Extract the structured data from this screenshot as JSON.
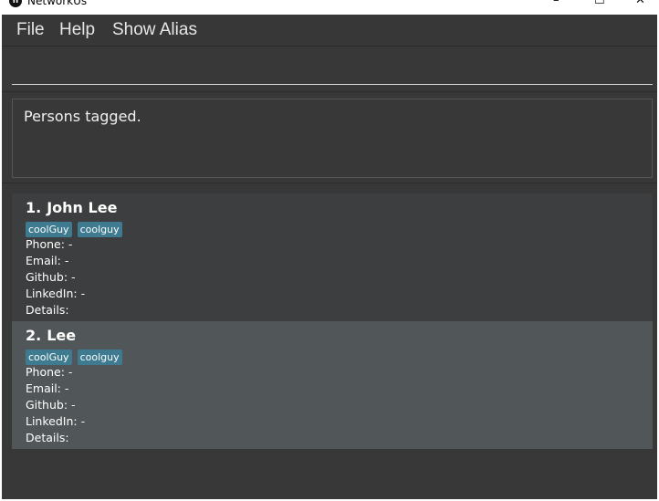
{
  "window": {
    "title": "NetworkUs",
    "icon_letter": "n",
    "minimize_glyph": "–",
    "maximize_glyph": "☐",
    "close_glyph": "✕"
  },
  "menu": {
    "file": "File",
    "help": "Help",
    "show_alias": "Show Alias"
  },
  "command": {
    "value": "",
    "placeholder": ""
  },
  "result": {
    "message": "Persons tagged."
  },
  "persons": [
    {
      "index": "1.",
      "name": "John Lee",
      "tags": [
        "coolGuy",
        "coolguy"
      ],
      "phone": "Phone: -",
      "email": "Email: -",
      "github": "Github: -",
      "linkedin": "LinkedIn: -",
      "details": "Details:"
    },
    {
      "index": "2.",
      "name": "Lee",
      "tags": [
        "coolGuy",
        "coolguy"
      ],
      "phone": "Phone: -",
      "email": "Email: -",
      "github": "Github: -",
      "linkedin": "LinkedIn: -",
      "details": "Details:"
    }
  ],
  "colors": {
    "background": "#383838",
    "tag": "#3e7b91",
    "card_selected": "#515658",
    "card": "#3c3e3f"
  }
}
